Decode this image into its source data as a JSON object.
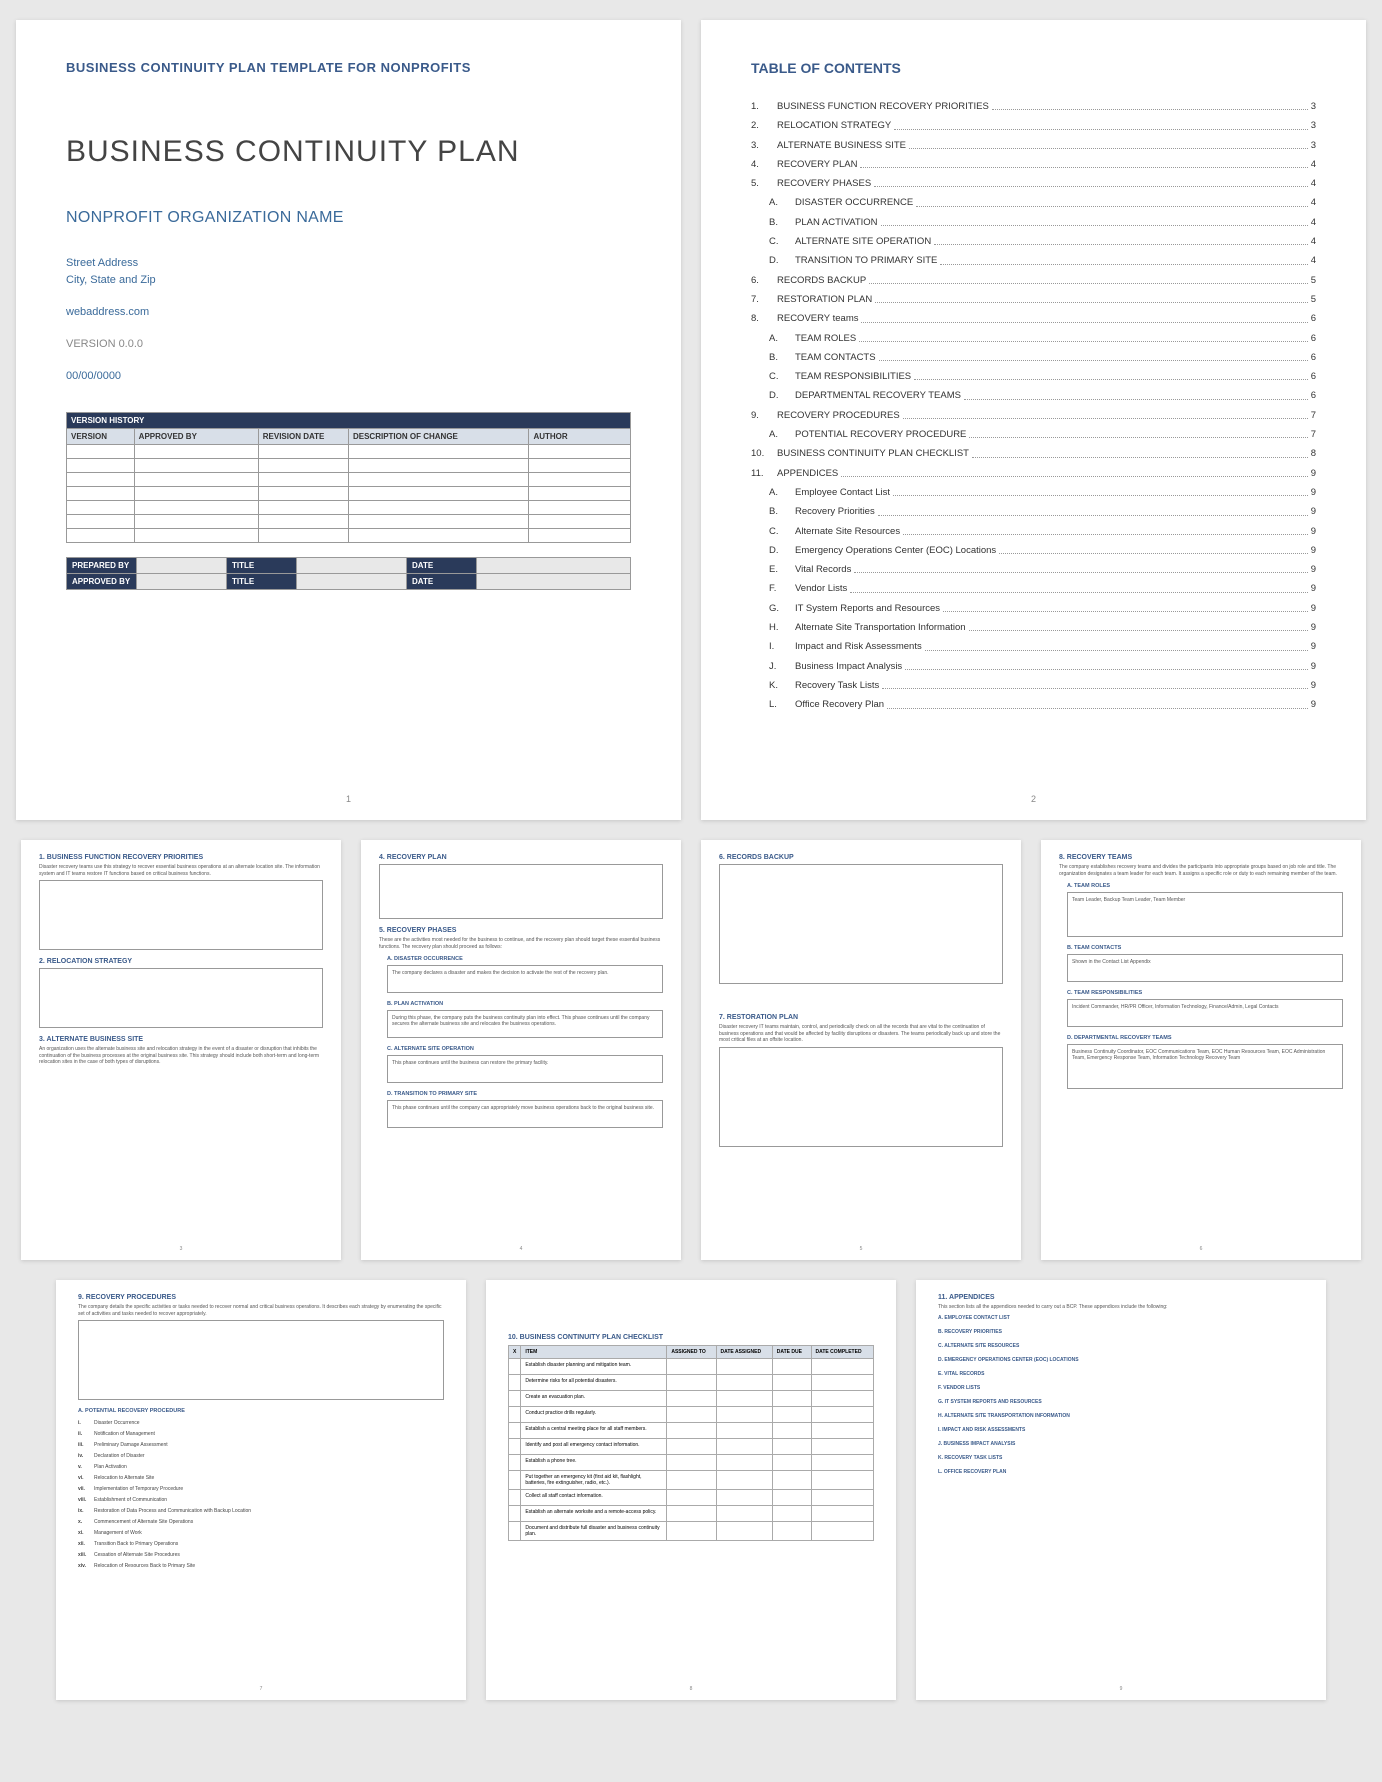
{
  "cover": {
    "template_name": "BUSINESS CONTINUITY PLAN TEMPLATE FOR NONPROFITS",
    "title": "BUSINESS CONTINUITY PLAN",
    "org_name": "NONPROFIT ORGANIZATION NAME",
    "street": "Street Address",
    "city_state_zip": "City, State and Zip",
    "web": "webaddress.com",
    "version": "VERSION 0.0.0",
    "date": "00/00/0000",
    "vh_title": "VERSION HISTORY",
    "vh_cols": [
      "VERSION",
      "APPROVED BY",
      "REVISION DATE",
      "DESCRIPTION OF CHANGE",
      "AUTHOR"
    ],
    "prep_rows": [
      [
        "PREPARED BY",
        "TITLE",
        "DATE"
      ],
      [
        "APPROVED BY",
        "TITLE",
        "DATE"
      ]
    ],
    "page_number": "1"
  },
  "toc": {
    "title": "TABLE OF CONTENTS",
    "items": [
      {
        "num": "1.",
        "label": "BUSINESS FUNCTION RECOVERY PRIORITIES",
        "pg": "3",
        "sub": false
      },
      {
        "num": "2.",
        "label": "RELOCATION STRATEGY",
        "pg": "3",
        "sub": false
      },
      {
        "num": "3.",
        "label": "ALTERNATE BUSINESS SITE",
        "pg": "3",
        "sub": false
      },
      {
        "num": "4.",
        "label": "RECOVERY PLAN",
        "pg": "4",
        "sub": false
      },
      {
        "num": "5.",
        "label": "RECOVERY PHASES",
        "pg": "4",
        "sub": false
      },
      {
        "num": "A.",
        "label": "DISASTER OCCURRENCE",
        "pg": "4",
        "sub": true
      },
      {
        "num": "B.",
        "label": "PLAN ACTIVATION",
        "pg": "4",
        "sub": true
      },
      {
        "num": "C.",
        "label": "ALTERNATE SITE OPERATION",
        "pg": "4",
        "sub": true
      },
      {
        "num": "D.",
        "label": "TRANSITION TO PRIMARY SITE",
        "pg": "4",
        "sub": true
      },
      {
        "num": "6.",
        "label": "RECORDS BACKUP",
        "pg": "5",
        "sub": false
      },
      {
        "num": "7.",
        "label": "RESTORATION PLAN",
        "pg": "5",
        "sub": false
      },
      {
        "num": "8.",
        "label": "RECOVERY teams",
        "pg": "6",
        "sub": false
      },
      {
        "num": "A.",
        "label": "TEAM ROLES",
        "pg": "6",
        "sub": true
      },
      {
        "num": "B.",
        "label": "TEAM CONTACTS",
        "pg": "6",
        "sub": true
      },
      {
        "num": "C.",
        "label": "TEAM RESPONSIBILITIES",
        "pg": "6",
        "sub": true
      },
      {
        "num": "D.",
        "label": "DEPARTMENTAL RECOVERY TEAMS",
        "pg": "6",
        "sub": true
      },
      {
        "num": "9.",
        "label": "RECOVERY PROCEDURES",
        "pg": "7",
        "sub": false
      },
      {
        "num": "A.",
        "label": "POTENTIAL RECOVERY PROCEDURE",
        "pg": "7",
        "sub": true
      },
      {
        "num": "10.",
        "label": "BUSINESS CONTINUITY PLAN CHECKLIST",
        "pg": "8",
        "sub": false
      },
      {
        "num": "11.",
        "label": "APPENDICES",
        "pg": "9",
        "sub": false
      },
      {
        "num": "A.",
        "label": "Employee Contact List",
        "pg": "9",
        "sub": true
      },
      {
        "num": "B.",
        "label": "Recovery Priorities",
        "pg": "9",
        "sub": true
      },
      {
        "num": "C.",
        "label": "Alternate Site Resources",
        "pg": "9",
        "sub": true
      },
      {
        "num": "D.",
        "label": "Emergency Operations Center (EOC) Locations",
        "pg": "9",
        "sub": true
      },
      {
        "num": "E.",
        "label": "Vital Records",
        "pg": "9",
        "sub": true
      },
      {
        "num": "F.",
        "label": "Vendor Lists",
        "pg": "9",
        "sub": true
      },
      {
        "num": "G.",
        "label": "IT System Reports and Resources",
        "pg": "9",
        "sub": true
      },
      {
        "num": "H.",
        "label": "Alternate Site Transportation Information",
        "pg": "9",
        "sub": true
      },
      {
        "num": "I.",
        "label": "Impact and Risk Assessments",
        "pg": "9",
        "sub": true
      },
      {
        "num": "J.",
        "label": "Business Impact Analysis",
        "pg": "9",
        "sub": true
      },
      {
        "num": "K.",
        "label": "Recovery Task Lists",
        "pg": "9",
        "sub": true
      },
      {
        "num": "L.",
        "label": "Office Recovery Plan",
        "pg": "9",
        "sub": true
      }
    ],
    "page_number": "2"
  },
  "p3": {
    "s1": {
      "hdr": "1. BUSINESS FUNCTION RECOVERY PRIORITIES",
      "sub": "Disaster recovery teams use this strategy to recover essential business operations at an alternate location site. The information system and IT teams restore IT functions based on critical business functions."
    },
    "s2": {
      "hdr": "2. RELOCATION STRATEGY",
      "sub": ""
    },
    "s3": {
      "hdr": "3. ALTERNATE BUSINESS SITE",
      "sub": "An organization uses the alternate business site and relocation strategy in the event of a disaster or disruption that inhibits the continuation of the business processes at the original business site. This strategy should include both short-term and long-term relocation sites in the case of both types of disruptions."
    },
    "page_number": "3"
  },
  "p4": {
    "s4": {
      "hdr": "4. RECOVERY PLAN"
    },
    "s5": {
      "hdr": "5. RECOVERY PHASES",
      "sub": "These are the activities most needed for the business to continue, and the recovery plan should target these essential business functions. The recovery plan should proceed as follows:"
    },
    "a": {
      "hdr": "A. DISASTER OCCURRENCE",
      "txt": "The company declares a disaster and makes the decision to activate the rest of the recovery plan."
    },
    "b": {
      "hdr": "B. PLAN ACTIVATION",
      "txt": "During this phase, the company puts the business continuity plan into effect. This phase continues until the company secures the alternate business site and relocates the business operations."
    },
    "c": {
      "hdr": "C. ALTERNATE SITE OPERATION",
      "txt": "This phase continues until the business can restore the primary facility."
    },
    "d": {
      "hdr": "D. TRANSITION TO PRIMARY SITE",
      "txt": "This phase continues until the company can appropriately move business operations back to the original business site."
    },
    "page_number": "4"
  },
  "p5": {
    "s6": {
      "hdr": "6. RECORDS BACKUP"
    },
    "s7": {
      "hdr": "7. RESTORATION PLAN",
      "sub": "Disaster recovery IT teams maintain, control, and periodically check on all the records that are vital to the continuation of business operations and that would be affected by facility disruptions or disasters. The teams periodically back up and store the most critical files at an offsite location."
    },
    "page_number": "5"
  },
  "p6": {
    "s8": {
      "hdr": "8. RECOVERY TEAMS",
      "sub": "The company establishes recovery teams and divides the participants into appropriate groups based on job role and title. The organization designates a team leader for each team. It assigns a specific role or duty to each remaining member of the team."
    },
    "a": {
      "hdr": "A. TEAM ROLES",
      "txt": "Team Leader, Backup Team Leader, Team Member"
    },
    "b": {
      "hdr": "B. TEAM CONTACTS",
      "txt": "Shown in the Contact List Appendix"
    },
    "c": {
      "hdr": "C. TEAM RESPONSIBILITIES",
      "txt": "Incident Commander, HR/PR Officer, Information Technology, Finance/Admin, Legal Contacts"
    },
    "d": {
      "hdr": "D. DEPARTMENTAL RECOVERY TEAMS",
      "txt": "Business Continuity Coordinator, EOC Communications Team, EOC Human Resources Team, EOC Administration Team, Emergency Response Team, Information Technology Recovery Team"
    },
    "page_number": "6"
  },
  "p7": {
    "hdr": "9. RECOVERY PROCEDURES",
    "sub": "The company details the specific activities or tasks needed to recover normal and critical business operations. It describes each strategy by enumerating the specific set of activities and tasks needed to recover appropriately.",
    "sub_hdr": "A. POTENTIAL RECOVERY PROCEDURE",
    "items": [
      {
        "n": "i.",
        "t": "Disaster Occurrence"
      },
      {
        "n": "ii.",
        "t": "Notification of Management"
      },
      {
        "n": "iii.",
        "t": "Preliminary Damage Assessment"
      },
      {
        "n": "iv.",
        "t": "Declaration of Disaster"
      },
      {
        "n": "v.",
        "t": "Plan Activation"
      },
      {
        "n": "vi.",
        "t": "Relocation to Alternate Site"
      },
      {
        "n": "vii.",
        "t": "Implementation of Temporary Procedure"
      },
      {
        "n": "viii.",
        "t": "Establishment of Communication"
      },
      {
        "n": "ix.",
        "t": "Restoration of Data Process and Communication with Backup Location"
      },
      {
        "n": "x.",
        "t": "Commencement of Alternate Site Operations"
      },
      {
        "n": "xi.",
        "t": "Management of Work"
      },
      {
        "n": "xii.",
        "t": "Transition Back to Primary Operations"
      },
      {
        "n": "xiii.",
        "t": "Cessation of Alternate Site Procedures"
      },
      {
        "n": "xiv.",
        "t": "Relocation of Resources Back to Primary Site"
      }
    ],
    "page_number": "7"
  },
  "p8": {
    "hdr": "10. BUSINESS CONTINUITY PLAN CHECKLIST",
    "cols": [
      "X",
      "ITEM",
      "ASSIGNED TO",
      "DATE ASSIGNED",
      "DATE DUE",
      "DATE COMPLETED"
    ],
    "items": [
      "Establish disaster planning and mitigation team.",
      "Determine risks for all potential disasters.",
      "Create an evacuation plan.",
      "Conduct practice drills regularly.",
      "Establish a central meeting place for all staff members.",
      "Identify and post all emergency contact information.",
      "Establish a phone tree.",
      "Put together an emergency kit (first aid kit, flashlight, batteries, fire extinguisher, radio, etc.).",
      "Collect all staff contact information.",
      "Establish an alternate worksite and a remote-access policy.",
      "Document and distribute full disaster and business continuity plan."
    ],
    "page_number": "8"
  },
  "p9": {
    "hdr": "11. APPENDICES",
    "sub": "This section lists all the appendices needed to carry out a BCP. These appendices include the following:",
    "items": [
      "A. EMPLOYEE CONTACT LIST",
      "B. RECOVERY PRIORITIES",
      "C. ALTERNATE SITE RESOURCES",
      "D. EMERGENCY OPERATIONS CENTER (EOC) LOCATIONS",
      "E. VITAL RECORDS",
      "F. VENDOR LISTS",
      "G. IT SYSTEM REPORTS AND RESOURCES",
      "H. ALTERNATE SITE TRANSPORTATION INFORMATION",
      "I. IMPACT AND RISK ASSESSMENTS",
      "J. BUSINESS IMPACT ANALYSIS",
      "K. RECOVERY TASK LISTS",
      "L. OFFICE RECOVERY PLAN"
    ],
    "page_number": "9"
  }
}
